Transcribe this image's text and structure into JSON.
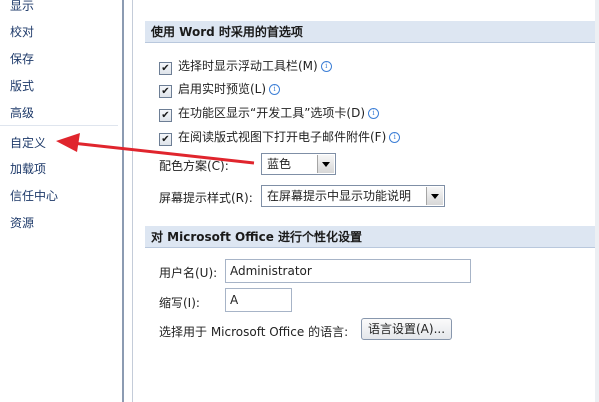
{
  "sidebar": {
    "items": [
      {
        "label": "显示"
      },
      {
        "label": "校对"
      },
      {
        "label": "保存"
      },
      {
        "label": "版式"
      },
      {
        "label": "高级"
      },
      {
        "label": "自定义"
      },
      {
        "label": "加载项"
      },
      {
        "label": "信任中心"
      },
      {
        "label": "资源"
      }
    ]
  },
  "section1": {
    "title": "使用 Word 时采用的首选项",
    "checkboxes": [
      {
        "label": "选择时显示浮动工具栏(M)",
        "checked": true
      },
      {
        "label": "启用实时预览(L)",
        "checked": true
      },
      {
        "label": "在功能区显示“开发工具”选项卡(D)",
        "checked": true
      },
      {
        "label": "在阅读版式视图下打开电子邮件附件(F)",
        "checked": true
      }
    ],
    "color_scheme": {
      "label": "配色方案(C):",
      "value": "蓝色"
    },
    "screentip": {
      "label": "屏幕提示样式(R):",
      "value": "在屏幕提示中显示功能说明"
    }
  },
  "section2": {
    "title": "对 Microsoft Office 进行个性化设置",
    "username": {
      "label": "用户名(U):",
      "value": "Administrator"
    },
    "initials": {
      "label": "缩写(I):",
      "value": "A"
    },
    "language": {
      "label": "选择用于 Microsoft Office 的语言:",
      "button": "语言设置(A)..."
    }
  },
  "colors": {
    "annotation_arrow": "#e0252d"
  }
}
